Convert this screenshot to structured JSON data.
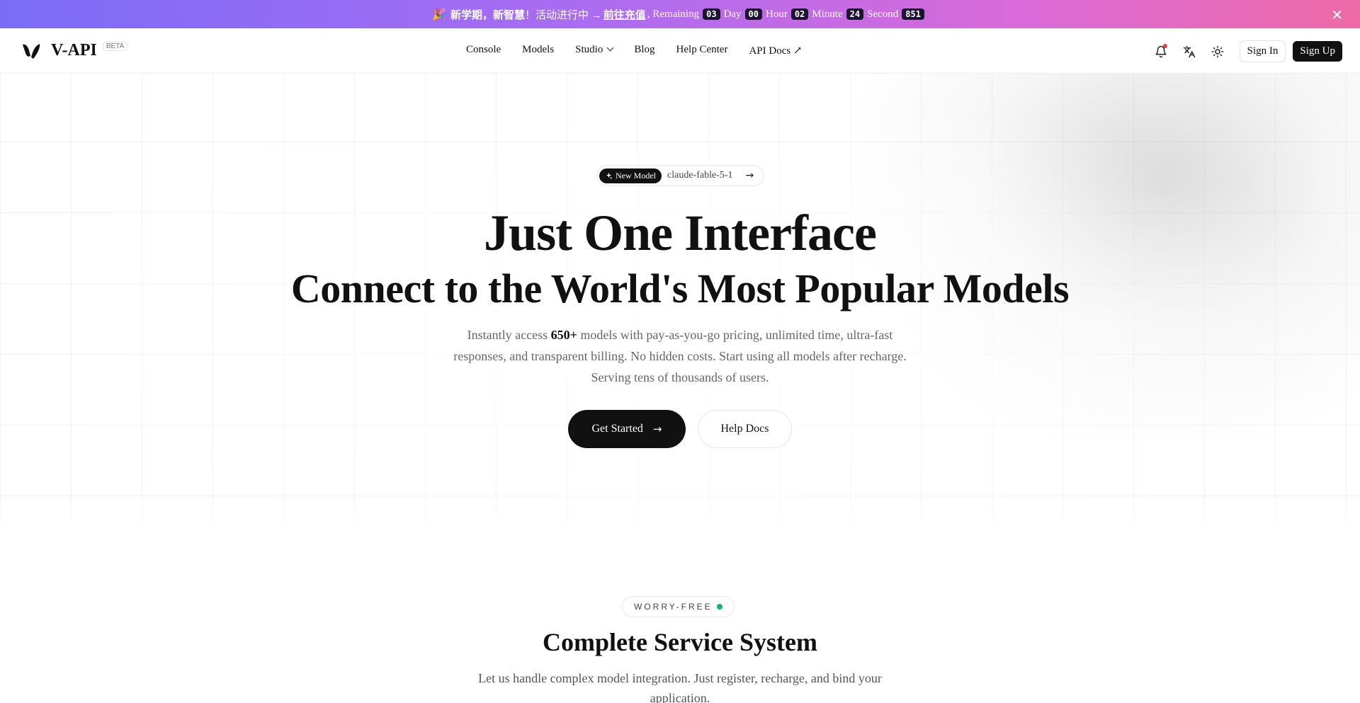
{
  "promo": {
    "party_icon": "party-popper-icon",
    "bold_text": "新学期，新智慧",
    "mid_text": "！活动进行中 →",
    "link_text": "前往充值",
    "remaining_label": ", Remaining",
    "days": "03",
    "day_label": "Day",
    "hours": "00",
    "hour_label": "Hour",
    "minutes": "02",
    "minute_label": "Minute",
    "seconds": "24",
    "second_label": "Second",
    "ms": "851",
    "close": "✕"
  },
  "nav": {
    "brand": "V-API",
    "beta": "BETA",
    "menu": [
      "Console",
      "Models",
      "Studio",
      "Blog",
      "Help Center",
      "API Docs ↗"
    ],
    "sign_in": "Sign In",
    "sign_up": "Sign Up"
  },
  "hero": {
    "pill_tag": "New Model",
    "pill_model": "claude-fable-5-1",
    "title": "Just One Interface",
    "subtitle": "Connect to the World's Most Popular Models",
    "desc_pre": "Instantly access ",
    "desc_bold": "650+",
    "desc_post": " models with pay-as-you-go pricing, unlimited time, ultra-fast responses, and transparent billing. No hidden costs. Start using all models after recharge. Serving tens of thousands of users.",
    "cta_primary": "Get Started",
    "cta_secondary": "Help Docs"
  },
  "section": {
    "badge": "WORRY-FREE",
    "title": "Complete Service System",
    "desc": "Let us handle complex model integration. Just register, recharge, and bind your application."
  },
  "colors": {
    "banner_start": "#7b6cf6",
    "banner_end": "#ee6aa6",
    "primary": "#111111",
    "status_green": "#14b36b",
    "notify_red": "#ef3b3b"
  }
}
